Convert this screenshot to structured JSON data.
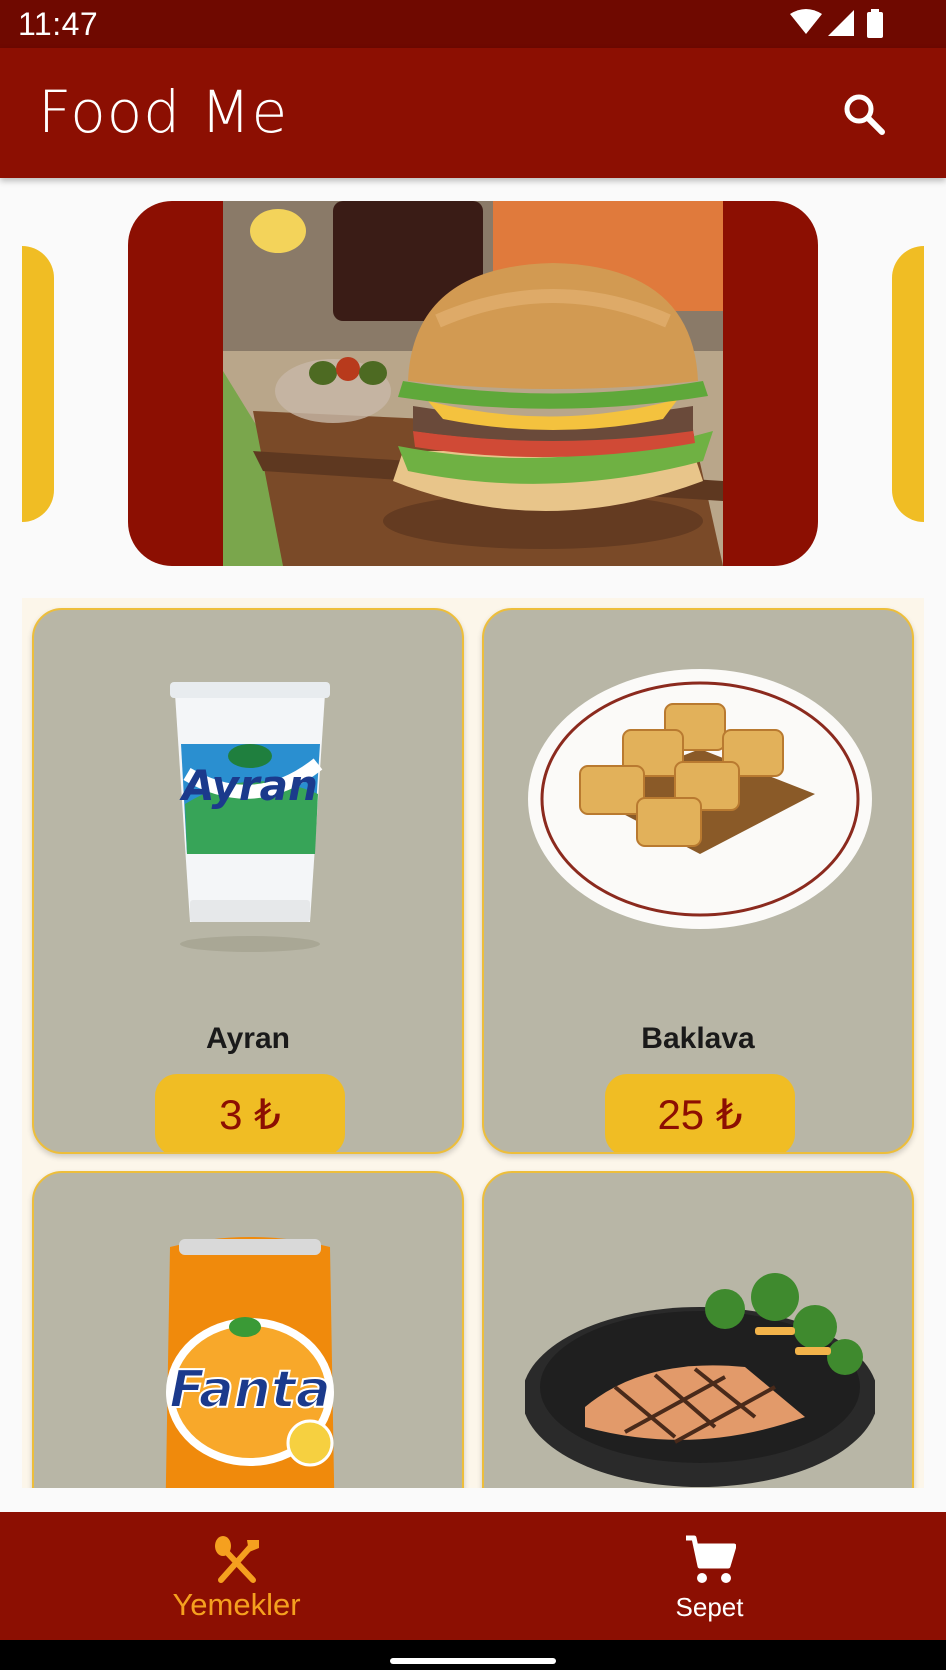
{
  "status_bar": {
    "time": "11:47"
  },
  "app_bar": {
    "title": "Food Me"
  },
  "products": [
    {
      "name": "Ayran",
      "price": "3 ₺"
    },
    {
      "name": "Baklava",
      "price": "25 ₺"
    },
    {
      "name": "",
      "price": ""
    },
    {
      "name": "",
      "price": ""
    }
  ],
  "bottom_nav": {
    "items": [
      {
        "label": "Yemekler",
        "active": true
      },
      {
        "label": "Sepet",
        "active": false
      }
    ]
  },
  "colors": {
    "status_bar": "#6f0900",
    "primary": "#8c0f02",
    "accent_yellow": "#f0bd24",
    "active_orange": "#f5a01f",
    "card_bg": "#b8b6a6"
  },
  "icons": [
    "wifi-icon",
    "signal-icon",
    "battery-icon",
    "search-icon",
    "fork-spoon-icon",
    "cart-icon"
  ]
}
